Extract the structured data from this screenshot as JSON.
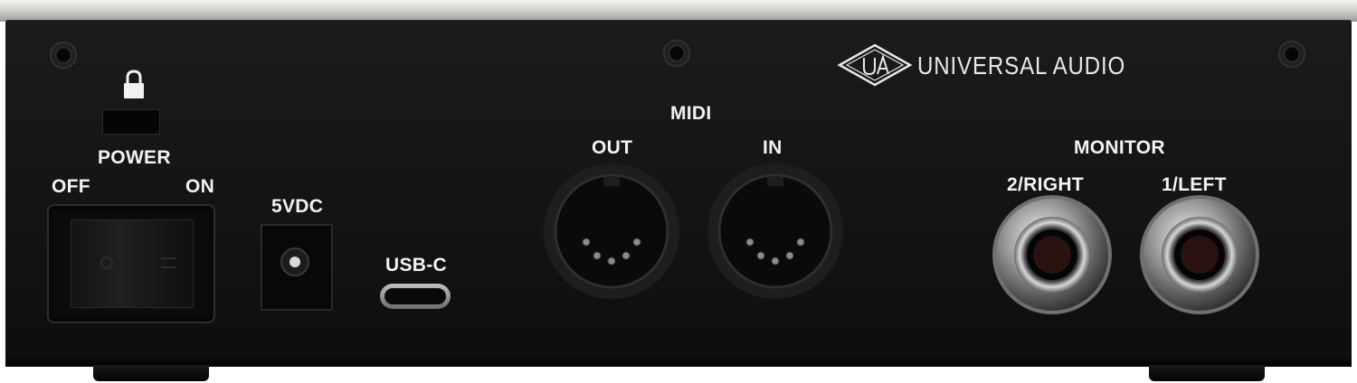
{
  "brand": {
    "name": "UNIVERSAL AUDIO",
    "logo_icon": "ua-diamond-logo-icon"
  },
  "power": {
    "lock_icon": "padlock-icon",
    "label": "POWER",
    "off_label": "OFF",
    "on_label": "ON"
  },
  "dc_input": {
    "label": "5VDC"
  },
  "usb": {
    "label": "USB-C"
  },
  "midi": {
    "label": "MIDI",
    "out_label": "OUT",
    "in_label": "IN"
  },
  "monitor": {
    "label": "MONITOR",
    "right_label": "2/RIGHT",
    "left_label": "1/LEFT"
  },
  "colors": {
    "panel": "#141415",
    "label_text": "#f2f2f2",
    "chrome": "#c8c8c8",
    "top_trim": "#e8e8e6"
  }
}
